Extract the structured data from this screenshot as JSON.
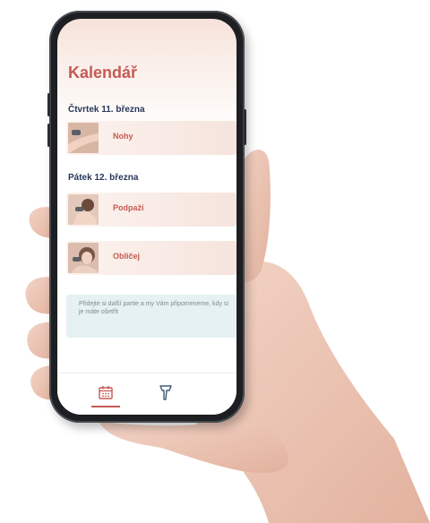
{
  "header": {
    "title": "Kalendář"
  },
  "days": [
    {
      "label": "Čtvrtek 11. března",
      "items": [
        {
          "label": "Nohy",
          "image": "legs-photo"
        }
      ]
    },
    {
      "label": "Pátek 12. března",
      "items": [
        {
          "label": "Podpaží",
          "image": "underarm-photo"
        },
        {
          "label": "Obličej",
          "image": "face-photo"
        }
      ]
    }
  ],
  "info": {
    "text": "Přidejte si další partie a my Vám připomeneme, kdy si je máte ošetřit"
  },
  "tabbar": {
    "tabs": [
      {
        "icon": "calendar-icon",
        "active": true
      },
      {
        "icon": "device-icon",
        "active": false
      }
    ]
  },
  "colors": {
    "accent": "#c65a53",
    "heading": "#27375c",
    "info_bg": "#e5f1f2"
  }
}
